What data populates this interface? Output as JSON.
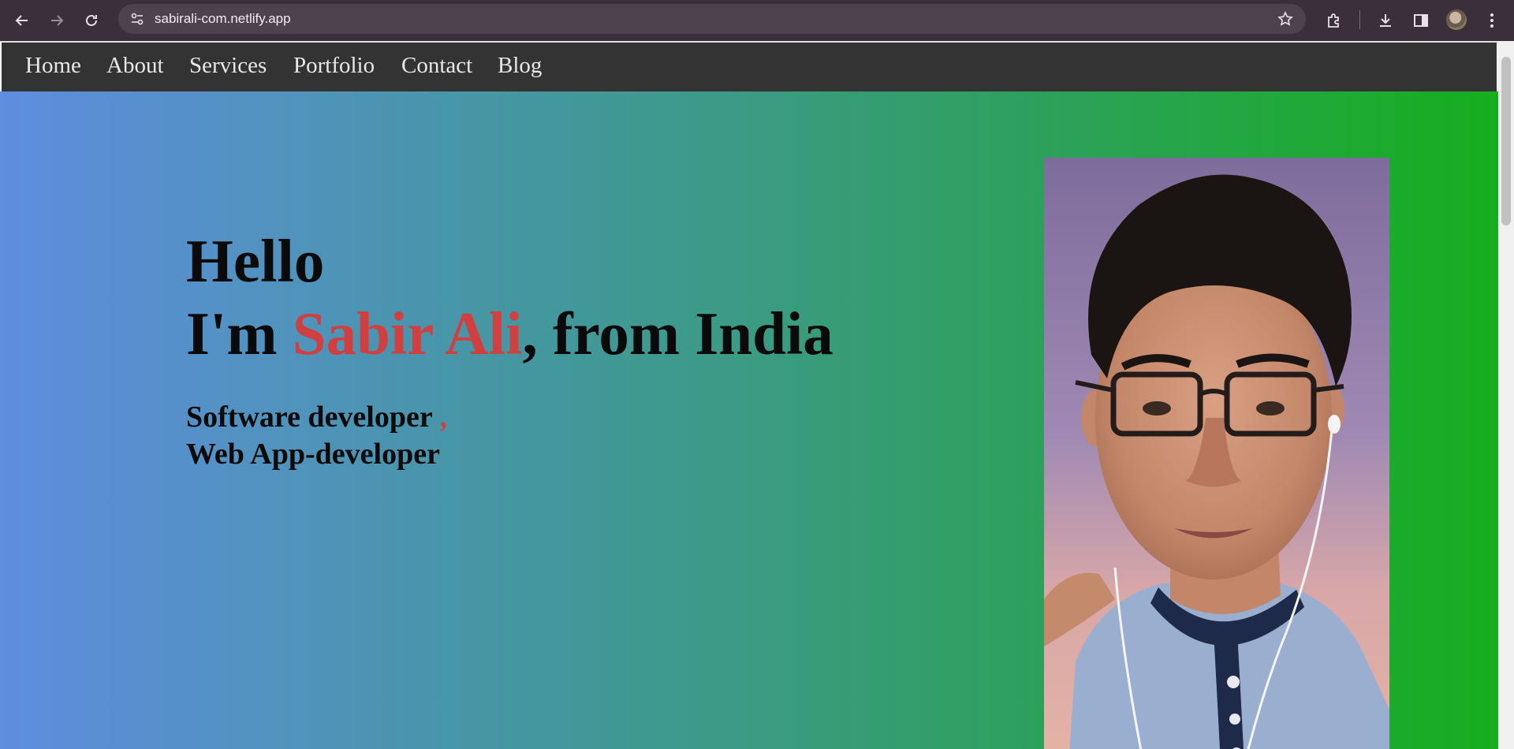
{
  "browser": {
    "url": "sabirali-com.netlify.app",
    "icons": [
      "back-icon",
      "forward-icon",
      "reload-icon",
      "site-settings-icon",
      "bookmark-star-icon",
      "extensions-icon",
      "downloads-icon",
      "side-panel-icon",
      "profile-avatar",
      "more-menu-icon"
    ]
  },
  "nav": {
    "items": [
      "Home",
      "About",
      "Services",
      "Portfolio",
      "Contact",
      "Blog"
    ]
  },
  "hero": {
    "greeting": "Hello",
    "intro_prefix": "I'm ",
    "name": "Sabir Ali",
    "intro_suffix": ", from India",
    "role_1": "Software developer",
    "role_separator": ",",
    "role_2": "Web App-developer",
    "photo": "portrait-photo"
  },
  "colors": {
    "nav_bg": "#333333",
    "name_accent": "#d04040",
    "gradient_start": "#5f8ddf",
    "gradient_end": "#16ae1e",
    "chrome_bg": "#3b2f3c"
  }
}
